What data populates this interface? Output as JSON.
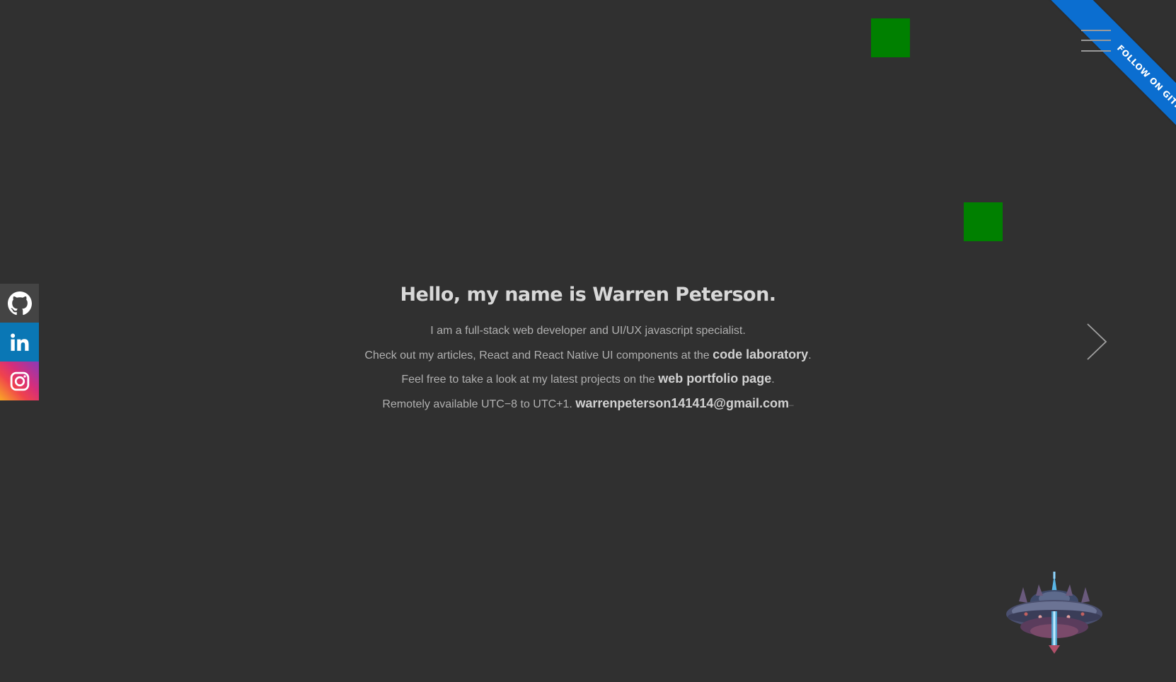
{
  "ribbon": {
    "label": "FOLLOW ON GITHUB",
    "color": "#0b6ed0"
  },
  "menu": {
    "icon": "hamburger-menu-icon"
  },
  "social": [
    {
      "name": "github",
      "icon": "github-icon",
      "color": "#444444"
    },
    {
      "name": "linkedin",
      "icon": "linkedin-icon",
      "color": "#0a77b5"
    },
    {
      "name": "instagram",
      "icon": "instagram-icon",
      "color": "#d62e7a"
    }
  ],
  "intro": {
    "heading": "Hello, my name is Warren Peterson.",
    "line1": "I am a full-stack web developer and UI/UX javascript specialist.",
    "line2_prefix": "Check out my articles, React and React Native UI components at the ",
    "line2_link": "code laboratory",
    "line2_suffix": ".",
    "line3_prefix": "Feel free to take a look at my latest projects on the ",
    "line3_link": "web portfolio page",
    "line3_suffix": ".",
    "line4_prefix": "Remotely available UTC−8 to UTC+1. ",
    "line4_link": "warrenpeterson141414@gmail.com",
    "line4_suffix": "–"
  },
  "decor": {
    "square_color": "#008000",
    "background": "#303030"
  },
  "nav": {
    "next_icon": "chevron-right-icon"
  }
}
